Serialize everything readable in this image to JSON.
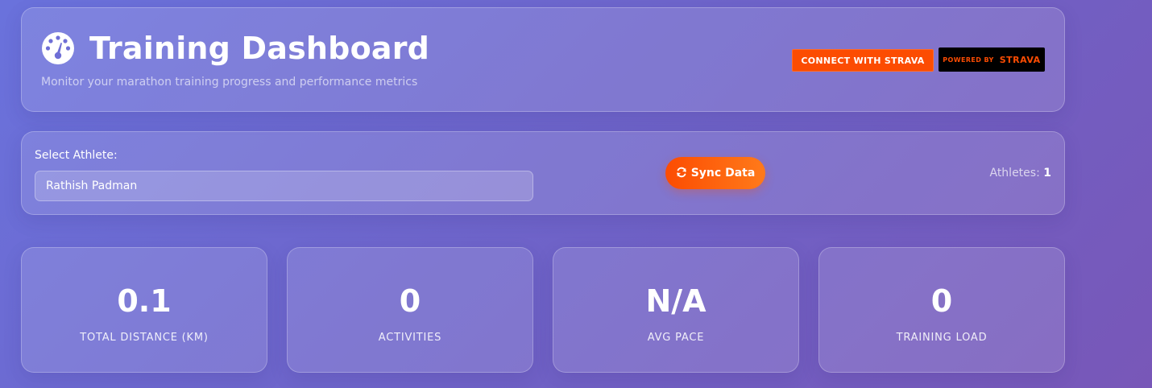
{
  "header": {
    "title": "Training Dashboard",
    "subtitle": "Monitor your marathon training progress and performance metrics",
    "icon": "tachometer-icon",
    "connect_strava_label": "CONNECT WITH STRAVA",
    "powered_by_label": "POWERED BY",
    "powered_by_brand": "STRAVA"
  },
  "controls": {
    "select_label": "Select Athlete:",
    "selected_athlete": "Rathish Padman",
    "sync_icon": "sync-icon",
    "sync_label": "Sync Data",
    "athletes_label": "Athletes:",
    "athletes_count": "1"
  },
  "stats": [
    {
      "value": "0.1",
      "label": "TOTAL DISTANCE (KM)"
    },
    {
      "value": "0",
      "label": "ACTIVITIES"
    },
    {
      "value": "N/A",
      "label": "AVG PACE"
    },
    {
      "value": "0",
      "label": "TRAINING LOAD"
    }
  ],
  "colors": {
    "strava_orange": "#fc4c02",
    "background_start": "#6a72dc",
    "background_end": "#7857b8"
  }
}
